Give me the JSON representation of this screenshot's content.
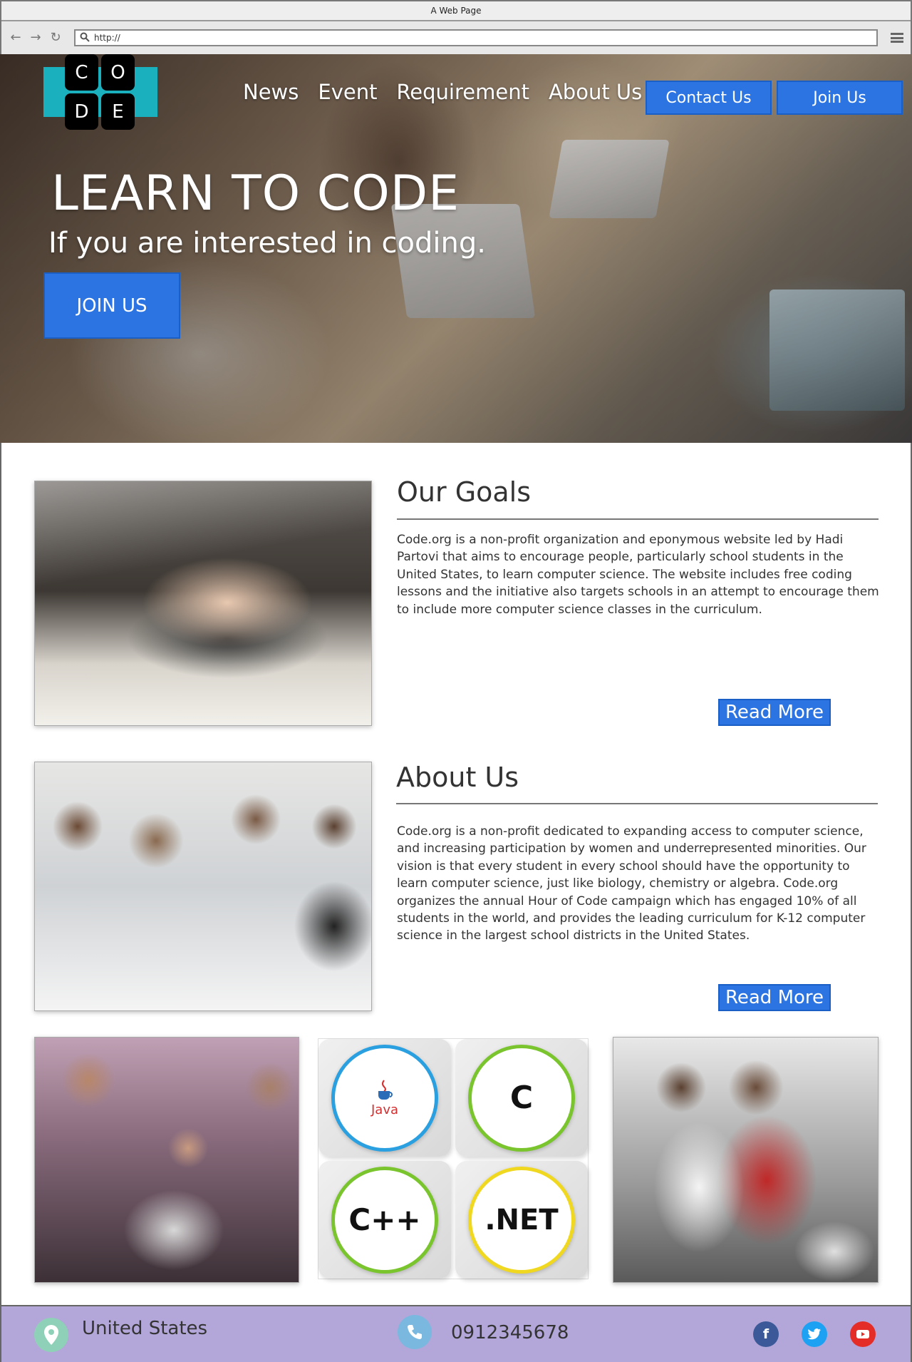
{
  "browser": {
    "title": "A Web Page",
    "url": "http://"
  },
  "logo": {
    "letters": [
      "C",
      "O",
      "D",
      "E"
    ],
    "accent_color": "#1ab0be"
  },
  "nav": {
    "links": [
      "News",
      "Event",
      "Requirement",
      "About Us"
    ],
    "contact_label": "Contact Us",
    "join_label": "Join Us"
  },
  "hero": {
    "title": "LEARN TO CODE",
    "subtitle": "If you are interested in coding.",
    "cta_label": "JOIN US"
  },
  "goals": {
    "title": "Our Goals",
    "text": "Code.org is a non-profit organization and eponymous website led by Hadi Partovi that aims to encourage people, particularly school students in the United States, to learn computer science. The website includes free coding lessons and the initiative also targets schools in an attempt to encourage them to include more computer science classes in the curriculum.",
    "read_more": "Read More"
  },
  "about": {
    "title": "About Us",
    "text": "Code.org is a non-profit dedicated to expanding access to computer science, and increasing participation by women and underrepresented minorities. Our vision is that every student in every school should have the opportunity to learn computer science, just like biology, chemistry or algebra. Code.org organizes the annual Hour of Code campaign which has engaged 10% of all students in the world, and provides the leading curriculum for K-12 computer science in the largest school districts in the United States.",
    "read_more": "Read More"
  },
  "languages": [
    {
      "label": "Java",
      "ring": "#2aa0e0"
    },
    {
      "label": "C",
      "ring": "#7ac52e"
    },
    {
      "label": "C++",
      "ring": "#7ac52e"
    },
    {
      "label": ".NET",
      "ring": "#f0d820"
    }
  ],
  "footer": {
    "location": "United States",
    "phone": "0912345678",
    "social": [
      "facebook-icon",
      "twitter-icon",
      "youtube-icon"
    ],
    "background": "#b3a6d8"
  },
  "colors": {
    "primary_button": "#2b74e2"
  }
}
